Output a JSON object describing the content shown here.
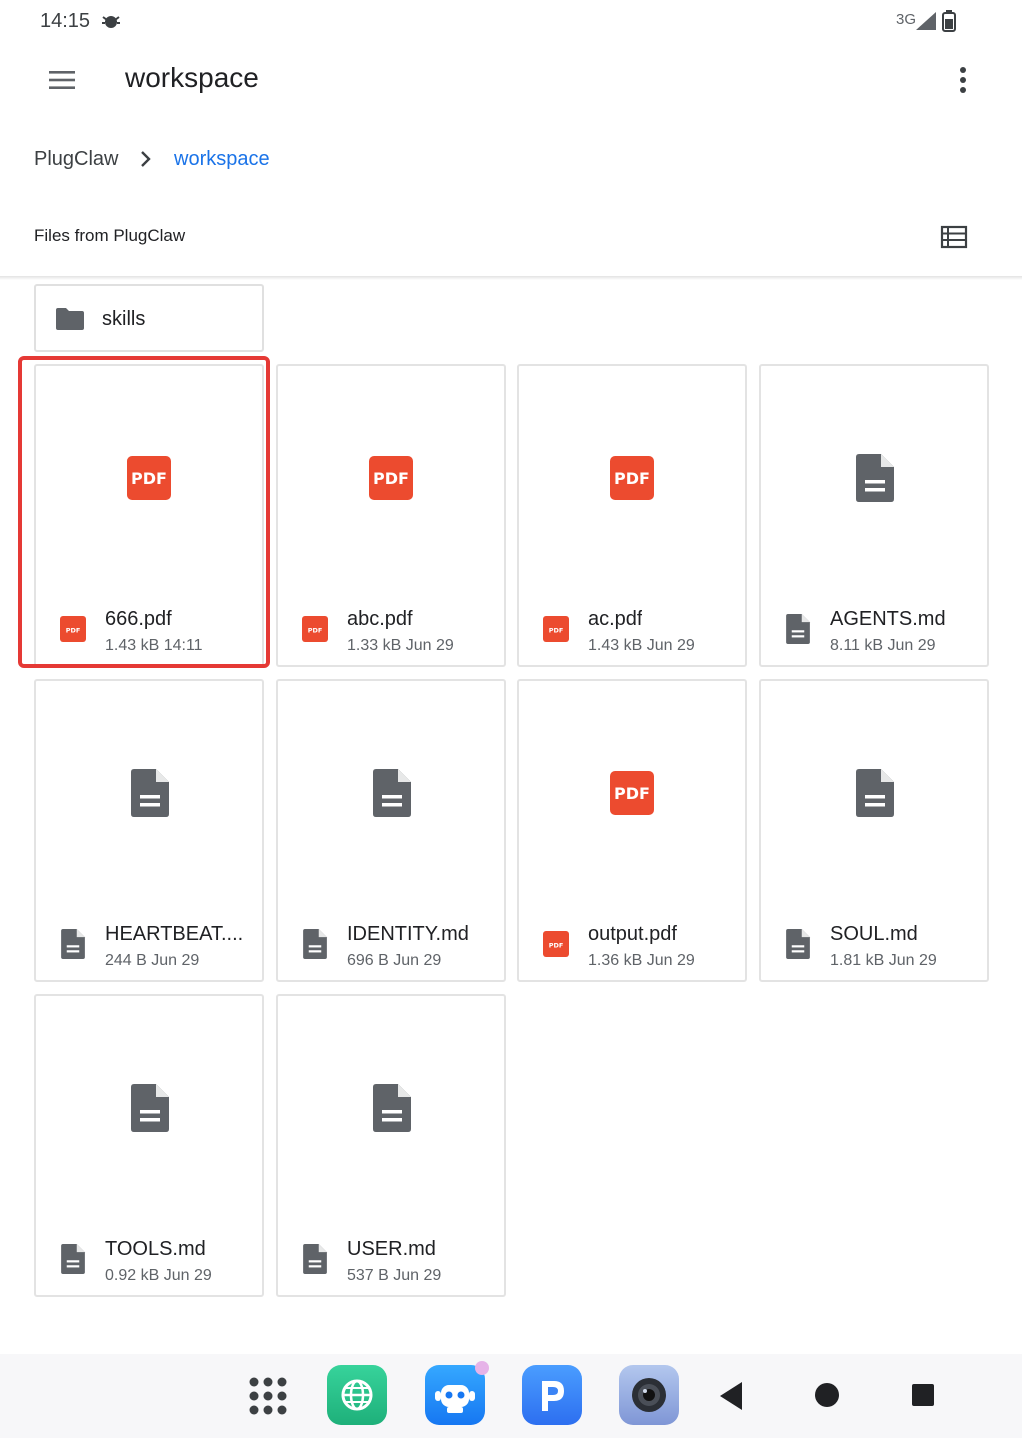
{
  "status_bar": {
    "time": "14:15",
    "network": "3G"
  },
  "app_bar": {
    "title": "workspace"
  },
  "breadcrumb": {
    "root": "PlugClaw",
    "current": "workspace"
  },
  "section": {
    "label": "Files from PlugClaw"
  },
  "folders": [
    {
      "name": "skills"
    }
  ],
  "files": [
    {
      "name": "666.pdf",
      "size": "1.43 kB",
      "date": "14:11",
      "type": "pdf",
      "selected": true
    },
    {
      "name": "abc.pdf",
      "size": "1.33 kB",
      "date": "Jun 29",
      "type": "pdf"
    },
    {
      "name": "ac.pdf",
      "size": "1.43 kB",
      "date": "Jun 29",
      "type": "pdf"
    },
    {
      "name": "AGENTS.md",
      "size": "8.11 kB",
      "date": "Jun 29",
      "type": "doc"
    },
    {
      "name": "HEARTBEAT....",
      "size": "244 B",
      "date": "Jun 29",
      "type": "doc"
    },
    {
      "name": "IDENTITY.md",
      "size": "696 B",
      "date": "Jun 29",
      "type": "doc"
    },
    {
      "name": "output.pdf",
      "size": "1.36 kB",
      "date": "Jun 29",
      "type": "pdf"
    },
    {
      "name": "SOUL.md",
      "size": "1.81 kB",
      "date": "Jun 29",
      "type": "doc"
    },
    {
      "name": "TOOLS.md",
      "size": "0.92 kB",
      "date": "Jun 29",
      "type": "doc"
    },
    {
      "name": "USER.md",
      "size": "537 B",
      "date": "Jun 29",
      "type": "doc"
    }
  ],
  "pdf_badge_text": "PDF",
  "colors": {
    "accent": "#1a73e8",
    "pdf_red": "#ec4b2f",
    "doc_gray": "#5f6368",
    "selection": "#e53935"
  },
  "icons": {
    "menu": "hamburger-menu-icon",
    "overflow": "more-vert-icon",
    "view": "list-view-icon",
    "folder": "folder-icon",
    "pdf": "pdf-file-icon",
    "doc": "document-icon"
  }
}
